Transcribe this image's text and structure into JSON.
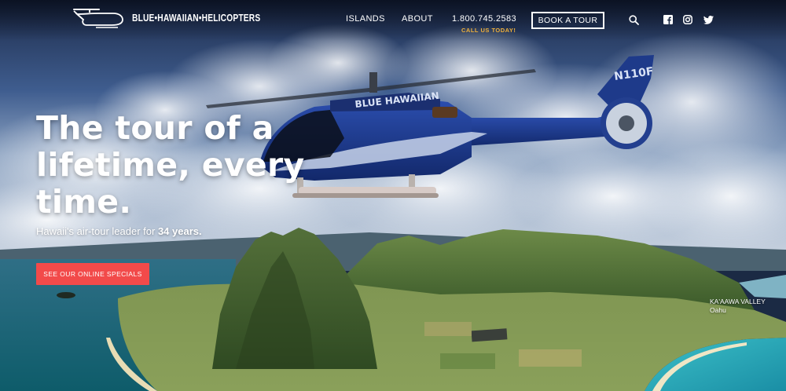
{
  "header": {
    "logo_text": "BLUE•HAWAIIAN•HELICOPTERS",
    "nav": [
      "ISLANDS",
      "ABOUT"
    ],
    "phone": "1.800.745.2583",
    "phone_note": "CALL US TODAY!",
    "cta": "BOOK A TOUR",
    "icons": [
      "search-icon",
      "facebook-icon",
      "instagram-icon",
      "twitter-icon"
    ]
  },
  "hero": {
    "headline": "The tour of a lifetime, every time.",
    "sub_prefix": "Hawaii's air-tour leader for ",
    "sub_bold": "34 years.",
    "cta": "SEE OUR ONLINE SPECIALS",
    "location": {
      "name": "KA'AAWA VALLEY",
      "region": "Oahu"
    },
    "helicopter_livery": "BLUE HAWAIIAN",
    "tail_number": "N110F"
  },
  "colors": {
    "accent_red": "#f24a4a",
    "call_note_gold": "#f0b13c",
    "helicopter_blue": "#1e3a8a"
  }
}
